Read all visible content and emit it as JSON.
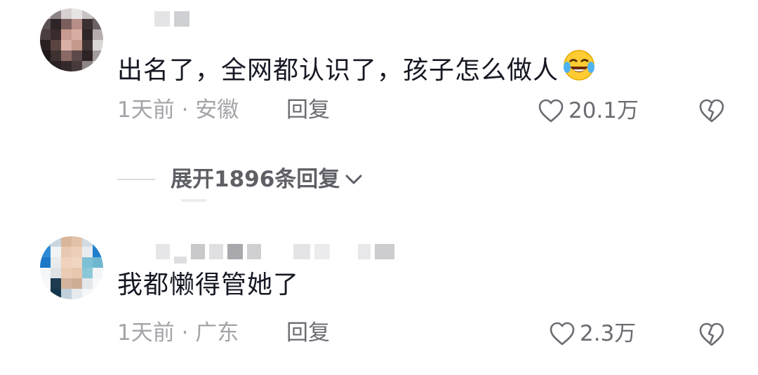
{
  "comments": [
    {
      "text": "出名了，全网都认识了，孩子怎么做人",
      "emoji": "rolling-on-floor-laughing",
      "meta": "1天前 · 安徽",
      "reply": "回复",
      "likes": "20.1万",
      "expand_replies": "展开1896条回复"
    },
    {
      "text": "我都懒得管她了",
      "meta": "1天前 · 广东",
      "reply": "回复",
      "likes": "2.3万"
    }
  ],
  "colors": {
    "text": "#161823",
    "meta": "#a3a4a8",
    "action": "#6b6c72",
    "expand": "#5f6066"
  }
}
